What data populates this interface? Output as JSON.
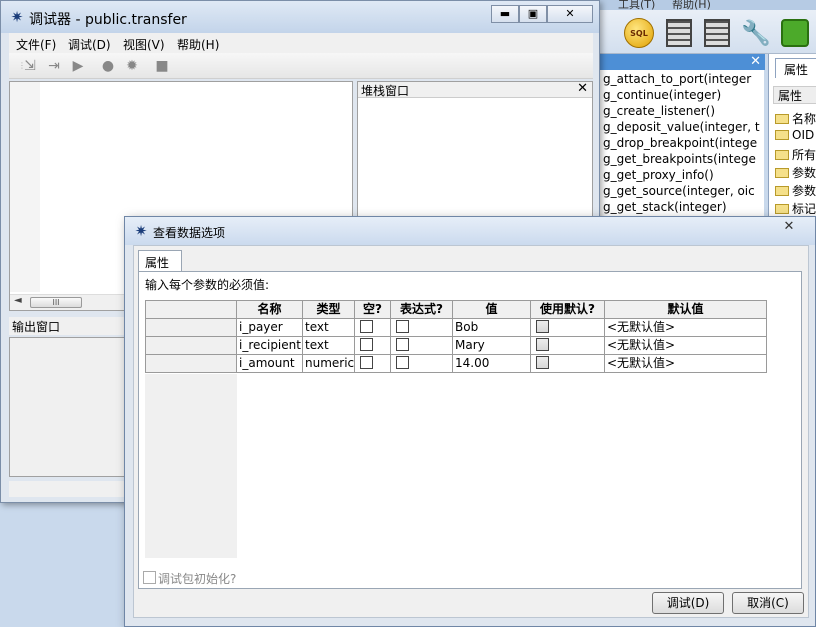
{
  "background_app": {
    "menu_items": [
      "工具(T)",
      "帮助(H)"
    ],
    "function_list": [
      "g_attach_to_port(integer",
      "g_continue(integer)",
      "g_create_listener()",
      "g_deposit_value(integer, t",
      "g_drop_breakpoint(intege",
      "g_get_breakpoints(intege",
      "g_get_proxy_info()",
      "g_get_source(integer, oic",
      "g_get_stack(integer)"
    ],
    "properties_tab": "属性",
    "properties_header": "属性",
    "properties_rows": [
      "名称",
      "OID",
      "所有",
      "参数",
      "参数",
      "标记"
    ],
    "sql_icon_text": "SQL"
  },
  "debugger": {
    "title": "调试器 - public.transfer",
    "menus": [
      "文件(F)",
      "调试(D)",
      "视图(V)",
      "帮助(H)"
    ],
    "stack_title": "堆栈窗口",
    "output_title": "输出窗口",
    "scroll_thumb": "III",
    "app_icon_glyph": "✷"
  },
  "dialog": {
    "title": "查看数据选项",
    "tab": "属性",
    "prompt": "输入每个参数的必须值:",
    "columns": [
      "名称",
      "类型",
      "空?",
      "表达式?",
      "值",
      "使用默认?",
      "默认值"
    ],
    "rows": [
      {
        "name": "i_payer",
        "type": "text",
        "value": "Bob",
        "default": "<无默认值>"
      },
      {
        "name": "i_recipient",
        "type": "text",
        "value": "Mary",
        "default": "<无默认值>"
      },
      {
        "name": "i_amount",
        "type": "numeric",
        "value": "14.00",
        "default": "<无默认值>"
      }
    ],
    "init_checkbox": "调试包初始化?",
    "debug_button": "调试(D)",
    "cancel_button": "取消(C)",
    "close_glyph": "✕"
  },
  "glyphs": {
    "close": "✕",
    "minimize": "▬",
    "maximize": "▣",
    "scroll_left": "◄"
  }
}
